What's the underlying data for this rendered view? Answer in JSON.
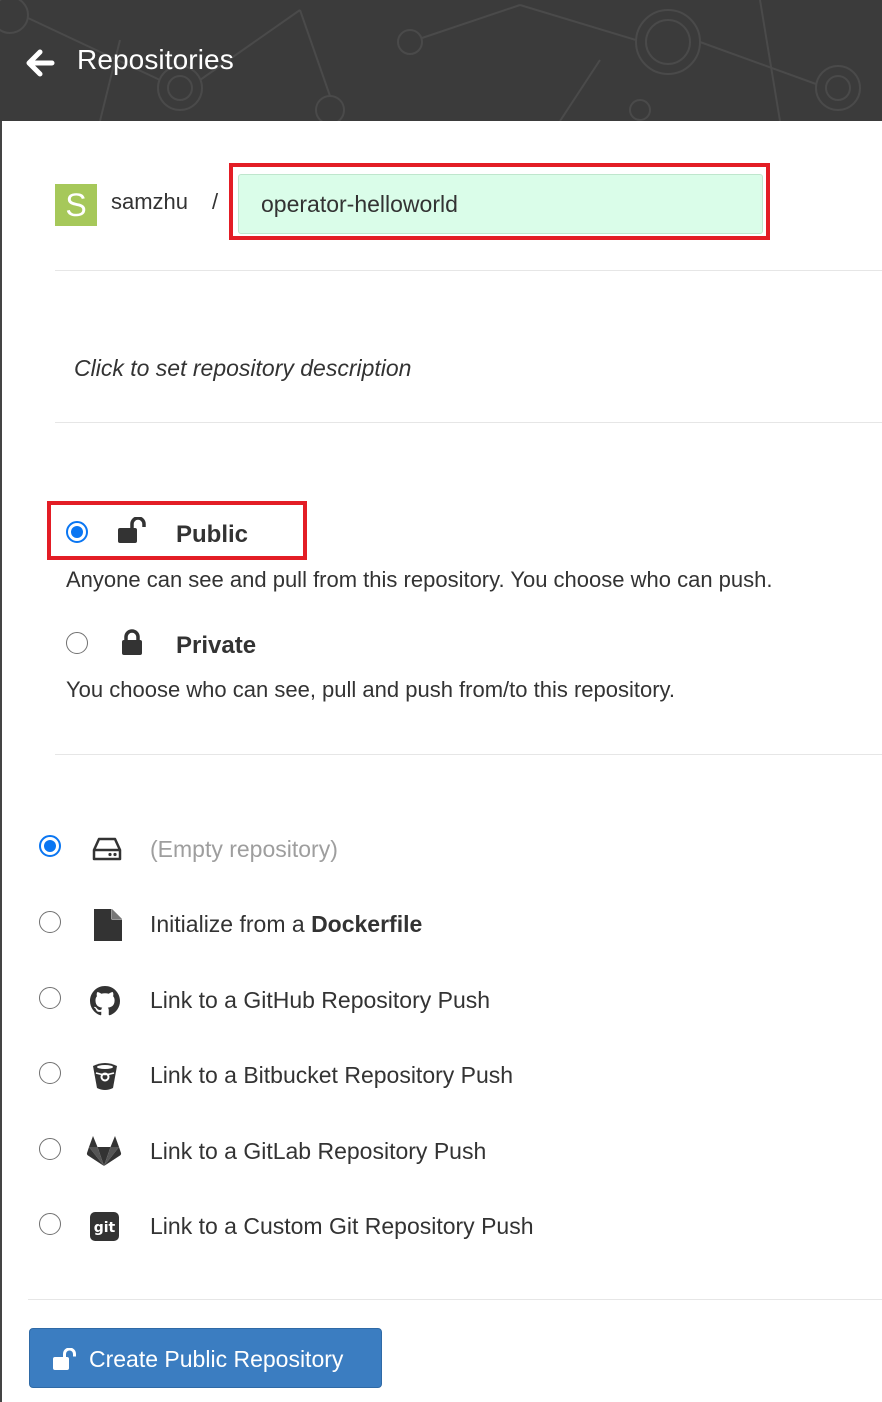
{
  "header": {
    "title": "Repositories",
    "back_icon": "arrow-left-icon"
  },
  "namespace": {
    "avatar_letter": "S",
    "avatar_color": "#a6c85a",
    "name": "samzhu",
    "separator": "/"
  },
  "repository_name": {
    "value": "operator-helloworld"
  },
  "description": {
    "placeholder_text": "Click to set repository description"
  },
  "visibility": {
    "options": [
      {
        "label": "Public",
        "icon": "unlock-icon",
        "selected": true,
        "description": "Anyone can see and pull from this repository. You choose who can push."
      },
      {
        "label": "Private",
        "icon": "lock-icon",
        "selected": false,
        "description": "You choose who can see, pull and push from/to this repository."
      }
    ]
  },
  "initialize": {
    "options": [
      {
        "label": "(Empty repository)",
        "icon": "hard-drive-icon",
        "selected": true
      },
      {
        "prefix": "Initialize from a ",
        "emphasis": "Dockerfile",
        "icon": "file-icon",
        "selected": false
      },
      {
        "label": "Link to a GitHub Repository Push",
        "icon": "github-icon",
        "selected": false
      },
      {
        "label": "Link to a Bitbucket Repository Push",
        "icon": "bitbucket-icon",
        "selected": false
      },
      {
        "label": "Link to a GitLab Repository Push",
        "icon": "gitlab-icon",
        "selected": false
      },
      {
        "label": "Link to a Custom Git Repository Push",
        "icon": "git-icon",
        "selected": false
      }
    ]
  },
  "create_button": {
    "label": "Create Public Repository",
    "icon": "unlock-icon"
  },
  "colors": {
    "header_bg": "#3b3b3b",
    "highlight": "#e31d25",
    "radio_selected": "#0a76f2",
    "input_bg": "#dafde9",
    "button_bg": "#3b7dc1"
  }
}
